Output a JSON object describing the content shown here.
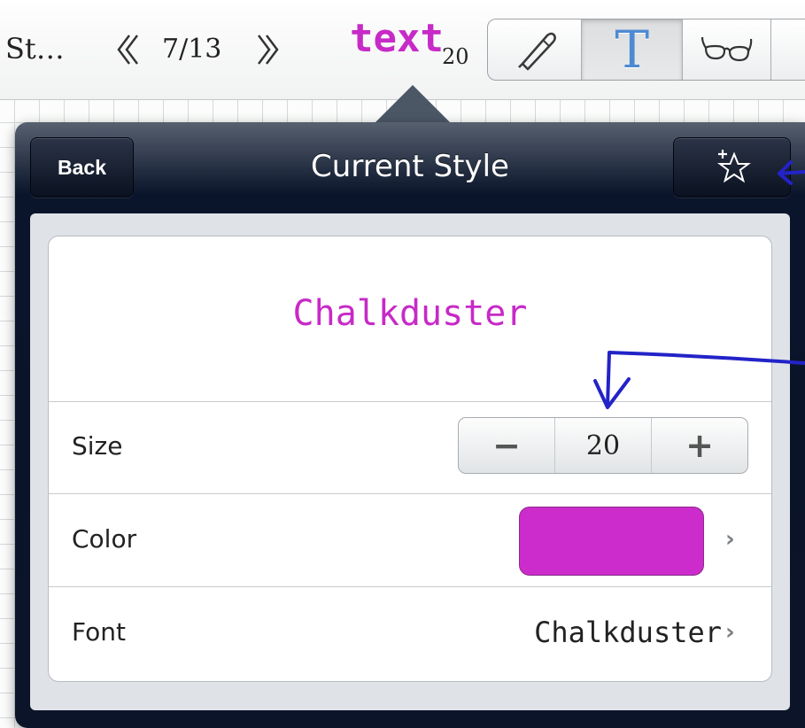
{
  "toolbar": {
    "document_title": "St…",
    "page_indicator": "7/13",
    "mode_label": "text",
    "mode_size": "20",
    "tools": [
      {
        "name": "pen-tool",
        "icon": "pen-icon"
      },
      {
        "name": "text-tool",
        "icon": "text-T-icon",
        "glyph": "T",
        "active": true
      },
      {
        "name": "view-tool",
        "icon": "glasses-icon"
      }
    ]
  },
  "popover": {
    "title": "Current Style",
    "back_label": "Back",
    "favorite_icon": "star-plus-icon"
  },
  "style": {
    "preview_text": "Chalkduster",
    "rows": {
      "size": {
        "label": "Size",
        "value": "20",
        "minus": "−",
        "plus": "+"
      },
      "color": {
        "label": "Color",
        "swatch": "#cc2ccb"
      },
      "font": {
        "label": "Font",
        "value": "Chalkduster"
      }
    },
    "chevron": "›"
  },
  "colors": {
    "accent": "#cc2ccb",
    "annotation": "#2323c8",
    "popover_bg": "#0b1428",
    "tool_active_blue": "#4d8ad2"
  }
}
